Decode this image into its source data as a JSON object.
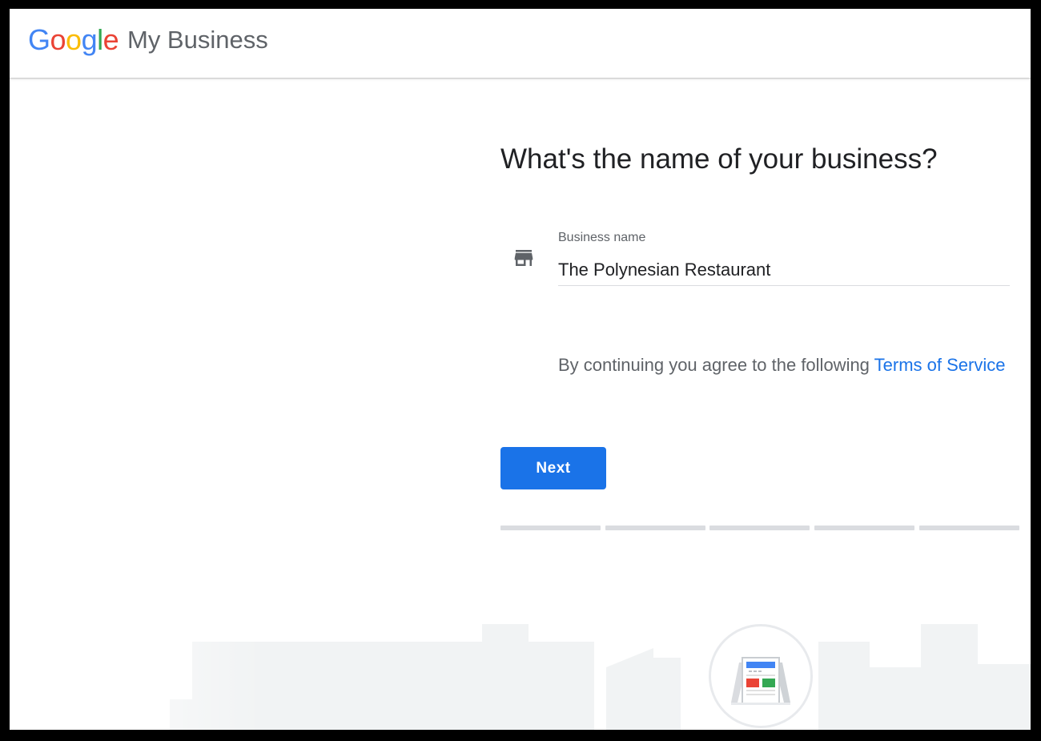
{
  "app": {
    "logo": {
      "g1": "G",
      "o1": "o",
      "o2": "o",
      "g2": "g",
      "l": "l",
      "e": "e"
    },
    "product_name": "My Business"
  },
  "form": {
    "heading": "What's the name of your business?",
    "field_label": "Business name",
    "field_value": "The Polynesian Restaurant",
    "field_icon": "storefront-icon",
    "terms_text": "By continuing you agree to the following ",
    "terms_link": "Terms of Service",
    "next_label": "Next"
  },
  "progress": {
    "total_steps": 5,
    "completed_steps": 0
  },
  "illustration": {
    "icon": "sandwich-board-sign-icon"
  },
  "colors": {
    "accent": "#1a73e8",
    "google_blue": "#4285F4",
    "google_red": "#EA4335",
    "google_yellow": "#FBBC05",
    "google_green": "#34A853",
    "progress_track": "#dadce0"
  }
}
